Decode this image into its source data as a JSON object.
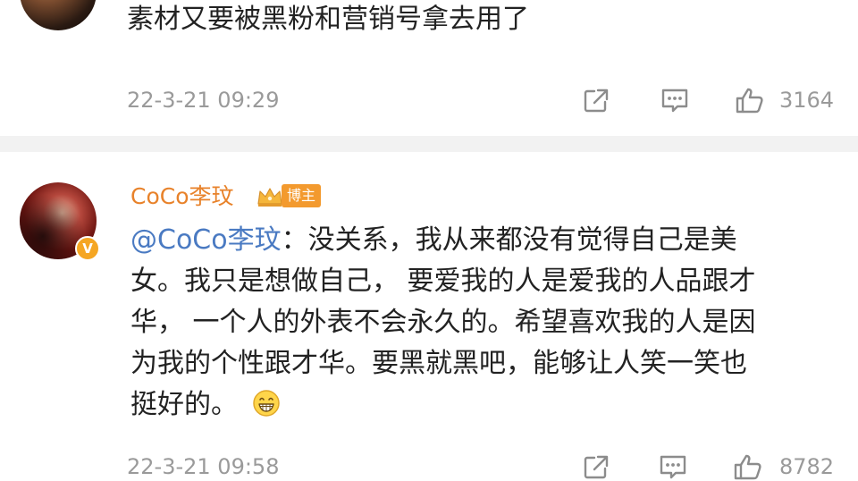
{
  "comments": [
    {
      "text": "素材又要被黑粉和营销号拿去用了",
      "time": "22-3-21 09:29",
      "like_count": "3164",
      "actions": [
        "share-icon",
        "comment-icon",
        "like-icon"
      ]
    },
    {
      "username": "CoCo李玟",
      "badge": "博主",
      "verified": "V",
      "mention": "@CoCo李玟",
      "body_lines": [
        "：没关系，我从来都没有觉得自己是美",
        "女。我只是想做自己， 要爱我的人是爱我的人品跟才",
        "华， 一个人的外表不会永久的。希望喜欢我的人是因",
        "为我的个性跟才华。要黑就黑吧，能够让人笑一笑也",
        "挺好的。"
      ],
      "emoji": "grin-emoji",
      "time": "22-3-21 09:58",
      "like_count": "8782",
      "actions": [
        "share-icon",
        "comment-icon",
        "like-icon"
      ]
    }
  ],
  "colors": {
    "username": "#e8822a",
    "mention": "#4a7ac2",
    "meta": "#9a9a9a",
    "badge_bg": "#f39a2e",
    "divider": "#f2f2f2"
  }
}
